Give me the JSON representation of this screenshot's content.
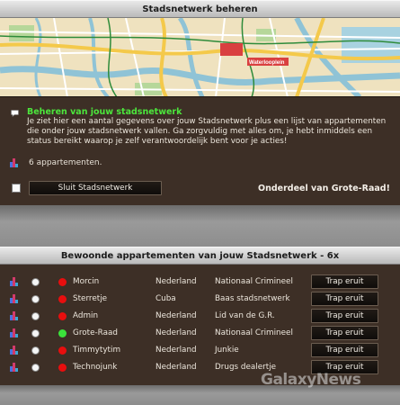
{
  "header": {
    "title": "Stadsnetwerk beheren"
  },
  "map": {
    "labels": [
      "Waterlooplein"
    ]
  },
  "intro": {
    "title": "Beheren van jouw stadsnetwerk",
    "text": "Je ziet hier een aantal gegevens over jouw Stadsnetwerk plus een lijst van appartementen die onder jouw stadsnetwerk vallen. Ga zorgvuldig met alles om, je hebt inmiddels een status bereikt waarop je zelf verantwoordelijk bent voor je acties!"
  },
  "summary": {
    "count_text": "6 appartementen."
  },
  "actions": {
    "close_button": "Sluit Stadsnetwerk",
    "part_of": "Onderdeel van Grote-Raad!"
  },
  "apartments": {
    "title": "Bewoonde appartementen van jouw Stadsnetwerk - 6x",
    "button_label": "Trap eruit",
    "rows": [
      {
        "name": "Morcin",
        "country": "Nederland",
        "role": "Nationaal Crimineel",
        "status": "red"
      },
      {
        "name": "Sterretje",
        "country": "Cuba",
        "role": "Baas stadsnetwerk",
        "status": "red"
      },
      {
        "name": "Admin",
        "country": "Nederland",
        "role": "Lid van de G.R.",
        "status": "red"
      },
      {
        "name": "Grote-Raad",
        "country": "Nederland",
        "role": "Nationaal Crimineel",
        "status": "green"
      },
      {
        "name": "Timmytytim",
        "country": "Nederland",
        "role": "Junkie",
        "status": "red"
      },
      {
        "name": "Technojunk",
        "country": "Nederland",
        "role": "Drugs dealertje",
        "status": "red"
      }
    ]
  },
  "watermark": {
    "text": "GalaxyNews"
  },
  "colors": {
    "status_red": "#e80e0e",
    "status_green": "#3be23b",
    "accent_green": "#4ce63c"
  }
}
